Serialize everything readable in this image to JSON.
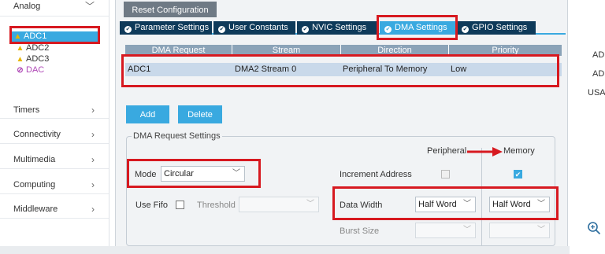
{
  "sidebar": {
    "analog": "Analog",
    "items": [
      {
        "label": "ADC1",
        "icon": "warning-icon"
      },
      {
        "label": "ADC2",
        "icon": "warning-icon"
      },
      {
        "label": "ADC3",
        "icon": "warning-icon"
      },
      {
        "label": "DAC",
        "icon": "disabled-icon"
      }
    ],
    "categories": [
      "Timers",
      "Connectivity",
      "Multimedia",
      "Computing",
      "Middleware"
    ]
  },
  "main": {
    "reset_label": "Reset Configuration",
    "tabs": [
      "Parameter Settings",
      "User Constants",
      "NVIC Settings",
      "DMA Settings",
      "GPIO Settings"
    ],
    "active_tab": "DMA Settings",
    "table": {
      "headers": [
        "DMA Request",
        "Stream",
        "Direction",
        "Priority"
      ],
      "rows": [
        [
          "ADC1",
          "DMA2 Stream 0",
          "Peripheral To Memory",
          "Low"
        ]
      ]
    },
    "add_label": "Add",
    "delete_label": "Delete",
    "settings": {
      "legend": "DMA Request Settings",
      "peripheral_header": "Peripheral",
      "memory_header": "Memory",
      "mode_label": "Mode",
      "mode_value": "Circular",
      "increment_label": "Increment Address",
      "peripheral_increment": false,
      "memory_increment": true,
      "use_fifo_label": "Use Fifo",
      "threshold_label": "Threshold",
      "threshold_value": "",
      "data_width_label": "Data Width",
      "peripheral_data_width": "Half Word",
      "memory_data_width": "Half Word",
      "burst_size_label": "Burst Size",
      "peripheral_burst": "",
      "memory_burst": ""
    }
  },
  "right_panel": {
    "lines": [
      "AD",
      "AD",
      "USA"
    ]
  },
  "colors": {
    "accent": "#39a9e0",
    "tab_dark": "#0e3a5a",
    "annotation_red": "#d71920"
  }
}
